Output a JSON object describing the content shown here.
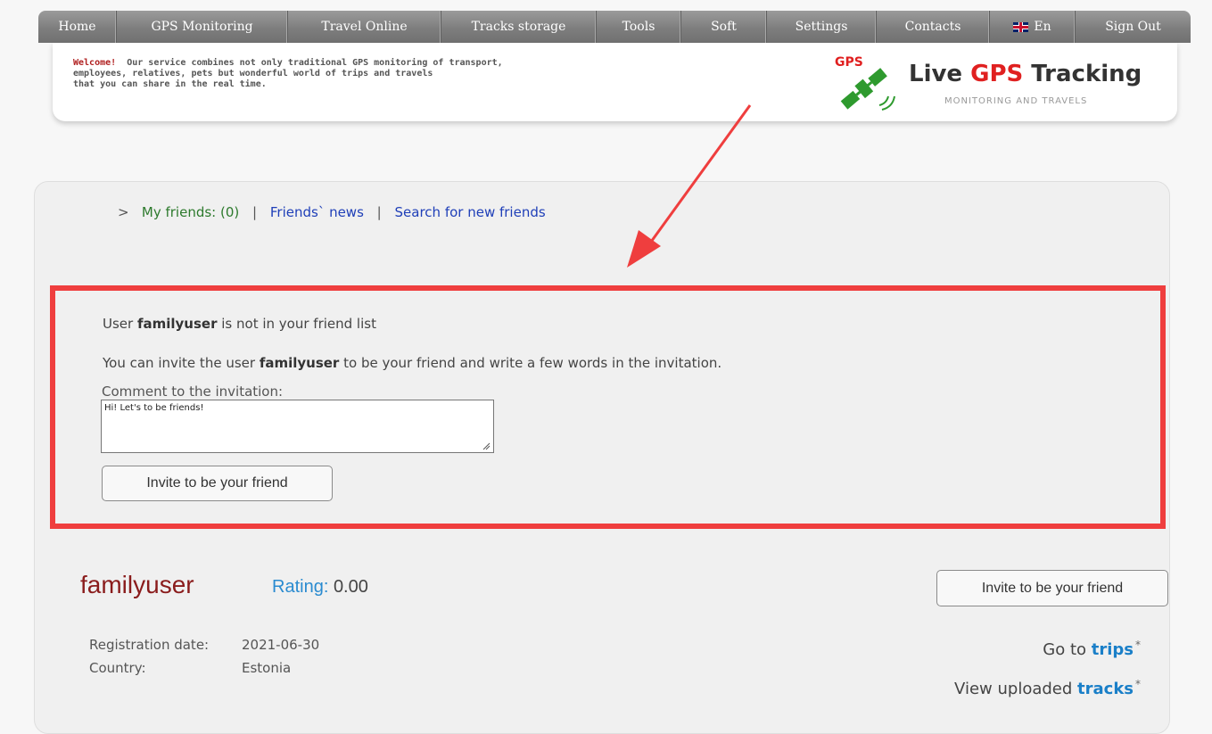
{
  "nav": {
    "items": [
      {
        "label": "Home"
      },
      {
        "label": "GPS Monitoring"
      },
      {
        "label": "Travel Online"
      },
      {
        "label": "Tracks storage"
      },
      {
        "label": "Tools"
      },
      {
        "label": "Soft"
      },
      {
        "label": "Settings"
      },
      {
        "label": "Contacts"
      },
      {
        "label": "En"
      },
      {
        "label": "Sign Out"
      }
    ]
  },
  "banner": {
    "welcome_bold": "Welcome!",
    "welcome_line1": "Our service combines not only traditional GPS monitoring of transport,",
    "welcome_line2": "employees, relatives, pets but wonderful world of trips and travels",
    "welcome_line3": "that you can share in the real time.",
    "logo_badge": "GPS",
    "logo_title_prefix": "Live ",
    "logo_title_accent": "GPS",
    "logo_title_suffix": " Tracking",
    "logo_subtitle": "MONITORING AND TRAVELS"
  },
  "friends_nav": {
    "prefix": ">",
    "my_friends": "My friends: (0)",
    "separator": "|",
    "friends_news": "Friends` news",
    "search_friends": "Search for new friends"
  },
  "invite": {
    "line1_pre": "User ",
    "line1_user": "familyuser",
    "line1_post": " is not in your friend list",
    "line2_pre": "You can invite the user ",
    "line2_user": "familyuser",
    "line2_post": " to be your friend and write a few words in the invitation.",
    "comment_label": "Comment to the invitation:",
    "comment_value": "Hi! Let's to be friends!",
    "button_label": "Invite to be your friend"
  },
  "profile": {
    "username": "familyuser",
    "rating_label": "Rating:",
    "rating_value": "0.00",
    "invite_button": "Invite to be your friend",
    "registration_label": "Registration date:",
    "registration_value": "2021-06-30",
    "country_label": "Country:",
    "country_value": "Estonia",
    "trips_pre": "Go to ",
    "trips_link": "trips",
    "tracks_pre": "View uploaded ",
    "tracks_link": "tracks",
    "asterisk": "*"
  },
  "colors": {
    "highlight": "#ef3e3e",
    "username": "#8a1c1c",
    "link": "#1f3fb8",
    "accent": "#e02020"
  }
}
